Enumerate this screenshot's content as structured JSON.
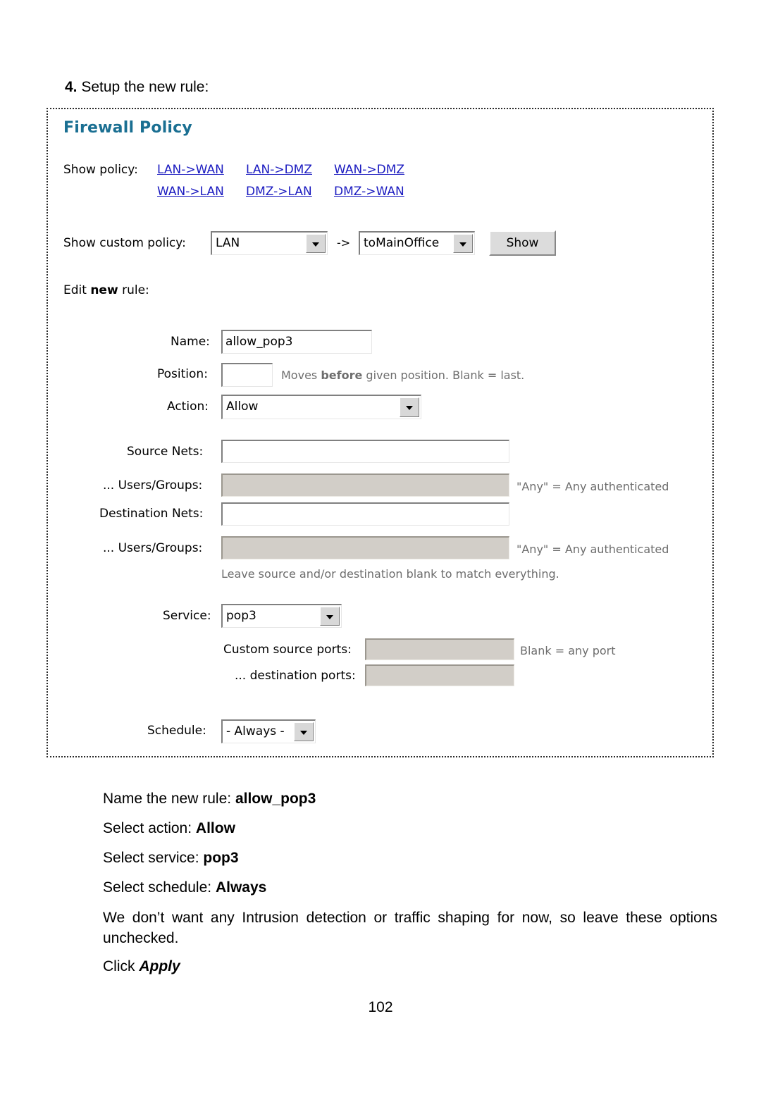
{
  "document": {
    "step_heading_number": "4.",
    "step_heading_text": "Setup the new rule:",
    "page_number": "102"
  },
  "screenshot": {
    "title": "Firewall Policy",
    "show_policy": {
      "label": "Show policy:",
      "links": [
        "LAN->WAN",
        "LAN->DMZ",
        "WAN->DMZ",
        "WAN->LAN",
        "DMZ->LAN",
        "DMZ->WAN"
      ]
    },
    "custom_policy": {
      "label": "Show custom policy:",
      "source_value": "LAN",
      "arrow": "->",
      "destination_value": "toMainOffice",
      "show_button": "Show"
    },
    "edit_section": {
      "prefix": "Edit ",
      "emphasis": "new",
      "suffix": " rule:"
    },
    "fields": {
      "name_label": "Name:",
      "name_value": "allow_pop3",
      "position_label": "Position:",
      "position_value": "",
      "position_hint_pre": "Moves ",
      "position_hint_bold": "before",
      "position_hint_post": " given position. Blank = last.",
      "action_label": "Action:",
      "action_value": "Allow",
      "source_nets_label": "Source Nets:",
      "source_nets_value": "",
      "source_users_label": "... Users/Groups:",
      "source_users_value": "",
      "source_users_hint": "\"Any\" = Any authenticated",
      "dest_nets_label": "Destination Nets:",
      "dest_nets_value": "",
      "dest_users_label": "... Users/Groups:",
      "dest_users_value": "",
      "dest_users_hint": "\"Any\" = Any authenticated",
      "blank_hint": "Leave source and/or destination blank to match everything.",
      "service_label": "Service:",
      "service_value": "pop3",
      "custom_source_ports_label": "Custom source ports:",
      "custom_source_ports_value": "",
      "custom_source_ports_hint": "Blank = any port",
      "dest_ports_label": "... destination ports:",
      "dest_ports_value": "",
      "schedule_label": "Schedule:",
      "schedule_value": "- Always -"
    }
  },
  "instructions": {
    "line1_pre": "Name the new rule: ",
    "line1_bold": "allow_pop3",
    "line2_pre": "Select action: ",
    "line2_bold": "Allow",
    "line3_pre": "Select service: ",
    "line3_bold": "pop3",
    "line4_pre": "Select schedule: ",
    "line4_bold": "Always",
    "paragraph": "We don’t want any Intrusion detection or traffic shaping for now, so leave these options unchecked.",
    "apply_pre": "Click ",
    "apply_bold": "Apply"
  },
  "colors": {
    "title_teal": "#1a6f92",
    "link_blue": "#1b1bc0",
    "hint_gray": "#6d6d6d",
    "disabled_field": "#d2cec8",
    "button_face": "#dcdcdc"
  }
}
